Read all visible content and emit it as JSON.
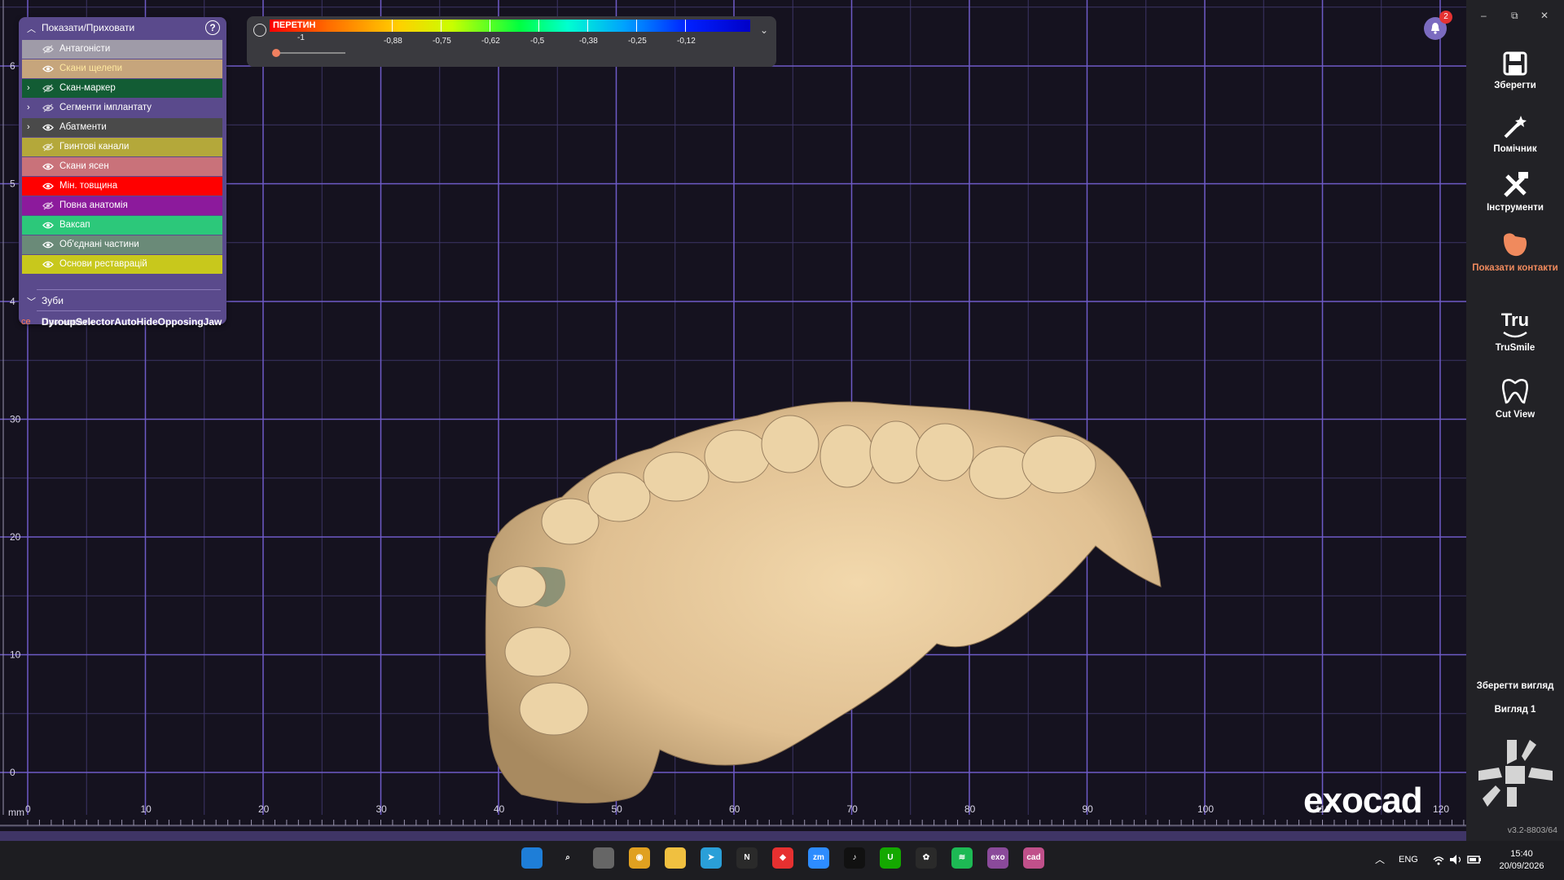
{
  "show_hide_panel": {
    "title": "Показати/Приховати",
    "layers": [
      {
        "label": "Антагоністи",
        "color": "#9f9ba8",
        "text_color": "#ffffff",
        "visible": false,
        "expandable": false
      },
      {
        "label": "Скани щелепи",
        "color": "#c6a57c",
        "text_color": "#ffe9a0",
        "visible": true,
        "expandable": false
      },
      {
        "label": "Скан-маркер",
        "color": "#125c34",
        "text_color": "#ffffff",
        "visible": false,
        "expandable": true
      },
      {
        "label": "Сегменти імплантату",
        "color": "#5a4a8c",
        "text_color": "#ffffff",
        "visible": false,
        "expandable": true
      },
      {
        "label": "Абатменти",
        "color": "#4a4a4a",
        "text_color": "#ffffff",
        "visible": true,
        "expandable": true
      },
      {
        "label": "Гвинтові канали",
        "color": "#b4a83a",
        "text_color": "#ffffff",
        "visible": false,
        "expandable": false
      },
      {
        "label": "Скани ясен",
        "color": "#c9727a",
        "text_color": "#ffffff",
        "visible": true,
        "expandable": false
      },
      {
        "label": "Мін. товщина",
        "color": "#ff0000",
        "text_color": "#ffffff",
        "visible": true,
        "expandable": false
      },
      {
        "label": "Повна анатомія",
        "color": "#8c1a9c",
        "text_color": "#ffffff",
        "visible": false,
        "expandable": false
      },
      {
        "label": "Ваксап",
        "color": "#2cc87a",
        "text_color": "#ffffff",
        "visible": true,
        "expandable": false
      },
      {
        "label": "Об'єднані частини",
        "color": "#6a8a78",
        "text_color": "#ffffff",
        "visible": true,
        "expandable": false
      },
      {
        "label": "Основи реставрацій",
        "color": "#c8c81c",
        "text_color": "#ffffff",
        "visible": true,
        "expandable": false
      }
    ],
    "teeth_label": "Зуби",
    "footer_prefix": "ce",
    "footer_label": "DyroupSelectorAutoHideOpposingJaw",
    "footer_overlap": "Приховати"
  },
  "color_scale": {
    "label": "ПЕРЕТИН",
    "values": [
      "-1",
      "-0,88",
      "-0,75",
      "-0,62",
      "-0,5",
      "-0,38",
      "-0,25",
      "-0,12"
    ],
    "slider_value": 0
  },
  "notifications": {
    "count": "2"
  },
  "window_controls": {
    "minimize": "–",
    "restore": "⧉",
    "close": "✕"
  },
  "toolbar": {
    "save": "Зберегти",
    "wizard": "Помічник",
    "tools": "Інструменти",
    "contacts": "Показати контакти",
    "trusmile": "TruSmile",
    "trusmile_icon_text": "Tru",
    "cut_view": "Cut View",
    "save_view": "Зберегти вигляд",
    "view_1": "Вигляд 1",
    "version": "v3.2-8803/64"
  },
  "viewport": {
    "x_ticks": [
      "0",
      "10",
      "20",
      "30",
      "40",
      "50",
      "60",
      "70",
      "80",
      "90",
      "100",
      "110",
      "120"
    ],
    "y_ticks": [
      "0",
      "10",
      "20",
      "30",
      "4",
      "5",
      "6"
    ],
    "unit": "mm",
    "brand": "exocad",
    "accent": "#6e5bc7"
  },
  "taskbar": {
    "tray_language": "ENG",
    "time": "15:40",
    "date": "20/09/2026",
    "apps": [
      "windows-start",
      "search",
      "task-view",
      "chrome",
      "file-explorer",
      "telegram",
      "notion",
      "anydesk",
      "zoom",
      "tiktok",
      "upwork",
      "chatgpt",
      "spotify",
      "exocad",
      "exocad-cad"
    ]
  }
}
